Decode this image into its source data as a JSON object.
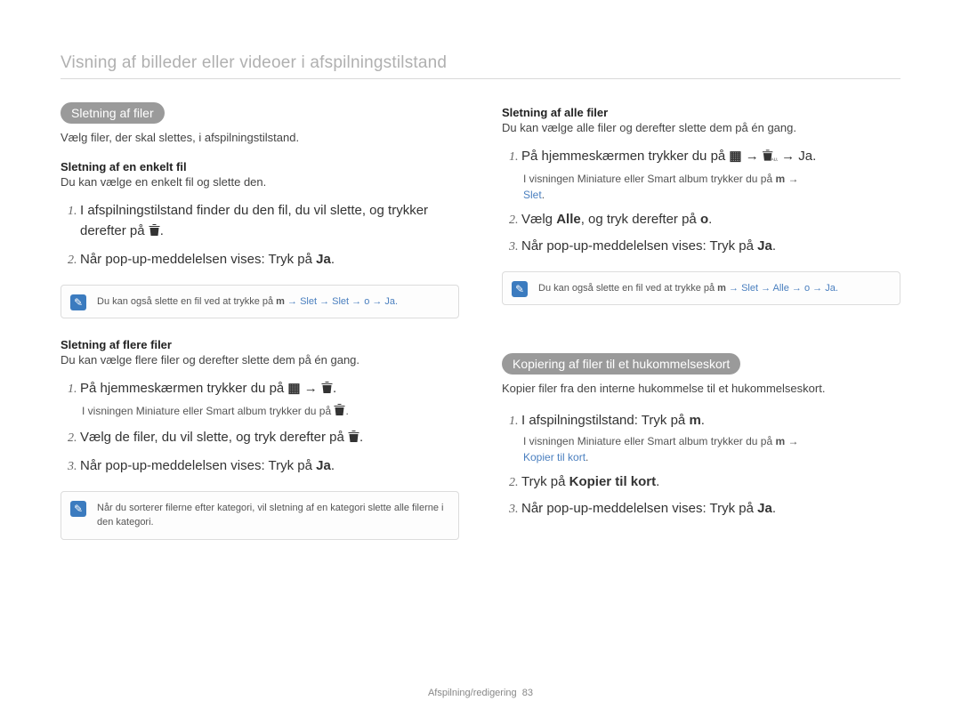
{
  "page_title": "Visning af billeder eller videoer i afspilningstilstand",
  "footer": {
    "section": "Afspilning/redigering",
    "page": "83"
  },
  "left": {
    "pill": "Sletning af ﬁler",
    "intro": "Vælg ﬁler, der skal slettes, i afspilningstilstand.",
    "sec1_head": "Sletning af en enkelt ﬁl",
    "sec1_desc": "Du kan vælge en enkelt ﬁl og slette den.",
    "sec1_step1": "I afspilningstilstand ﬁnder du den ﬁl, du vil slette, og trykker derefter på ",
    "sec1_step2": "Når pop-up-meddelelsen vises: Tryk på ",
    "sec1_step2_tail": "Ja",
    "sec1_step2_period": ".",
    "note1_prefix": "Du kan også slette en ﬁl ved at trykke på ",
    "note1_m": "m",
    "note1_flow": " → Slet → Slet → o → Ja.",
    "sec2_head": "Sletning af ﬂere ﬁler",
    "sec2_desc": "Du kan vælge ﬂere ﬁler og derefter slette dem på én gang.",
    "sec2_step1": "På hjemmeskærmen trykker du på ",
    "sec2_step1_sub": "I visningen Miniature eller Smart album trykker du på ",
    "sec2_step2": "Vælg de ﬁler, du vil slette, og tryk derefter på ",
    "sec2_step3": "Når pop-up-meddelelsen vises: Tryk på ",
    "sec2_step3_tail": "Ja",
    "note2": "Når du sorterer ﬁlerne efter kategori, vil sletning af en kategori slette alle ﬁlerne i den kategori."
  },
  "right": {
    "sec3_head": "Sletning af alle ﬁler",
    "sec3_desc": "Du kan vælge alle ﬁler og derefter slette dem på én gang.",
    "sec3_step1": "På hjemmeskærmen trykker du på ",
    "sec3_step1_tail": " → Ja.",
    "sec3_step1_sub": "I visningen Miniature eller Smart album trykker du på ",
    "sec3_step1_sub_m": "m",
    "sec3_step1_sub_tail": "Slet",
    "sec3_step2_a": "Vælg ",
    "sec3_step2_b": "Alle",
    "sec3_step2_c": ", og tryk derefter på ",
    "sec3_step2_d": "o",
    "sec3_step3": "Når pop-up-meddelelsen vises: Tryk på ",
    "sec3_step3_tail": "Ja",
    "note3_prefix": "Du kan også slette en ﬁl ved at trykke på ",
    "note3_m": "m",
    "note3_flow": " → Slet → Alle → o → Ja.",
    "pill2": "Kopiering af ﬁler til et hukommelseskort",
    "intro2": "Kopier ﬁler fra den interne hukommelse til et hukommelseskort.",
    "sec4_step1_a": "I afspilningstilstand: Tryk på ",
    "sec4_step1_b": "m",
    "sec4_step1_sub": "I visningen Miniature eller Smart album trykker du på ",
    "sec4_step1_sub_m": "m",
    "sec4_step1_sub_tail": "Kopier til kort",
    "sec4_step2_a": "Tryk på ",
    "sec4_step2_b": "Kopier til kort",
    "sec4_step3": "Når pop-up-meddelelsen vises: Tryk på ",
    "sec4_step3_tail": "Ja"
  }
}
